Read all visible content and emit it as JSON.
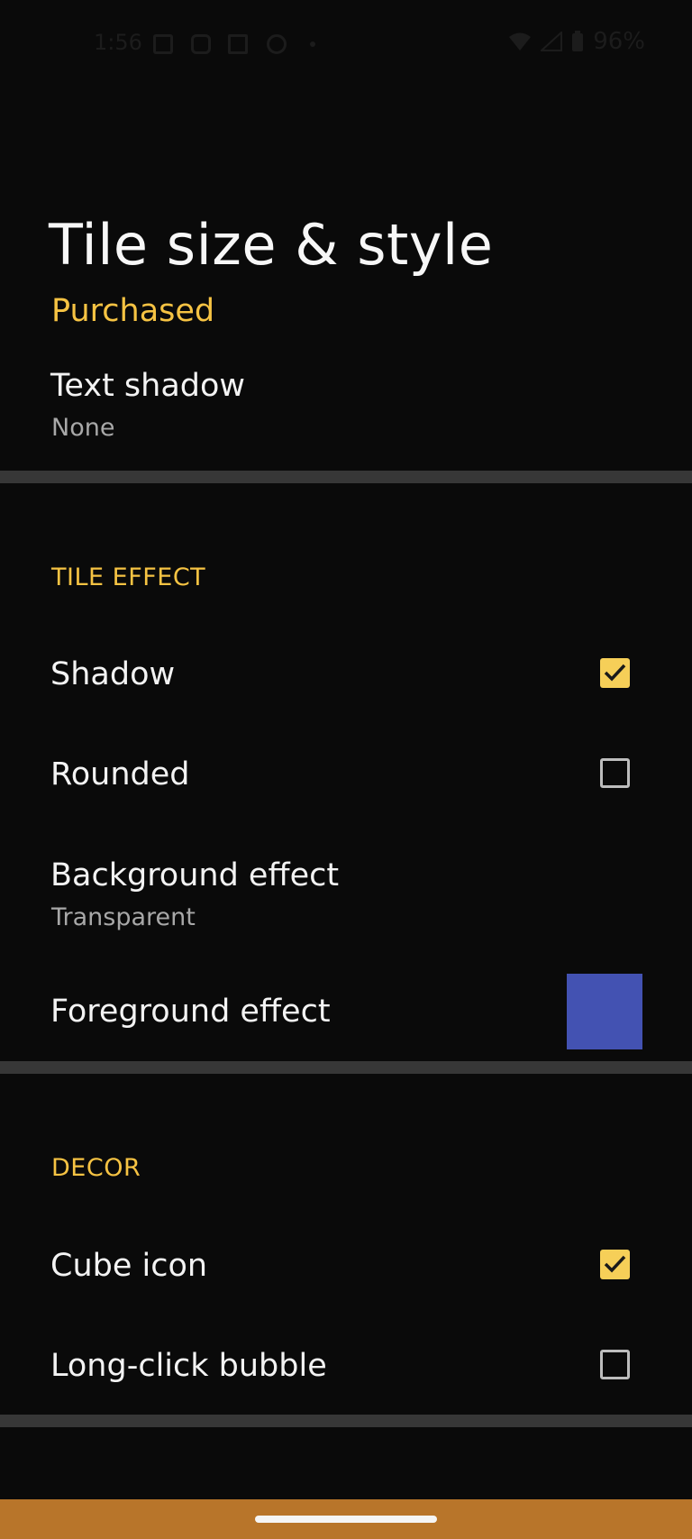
{
  "status_bar": {
    "time": "1:56",
    "battery": "96%",
    "icons": [
      "image-icon",
      "instagram-icon",
      "mail-icon",
      "alarm-icon",
      "wifi-icon",
      "signal-icon",
      "battery-icon"
    ]
  },
  "header": {
    "title": "Tile size & style",
    "purchase_status": "Purchased"
  },
  "text_shadow": {
    "label": "Text shadow",
    "value": "None"
  },
  "tile_effect": {
    "section_title": "TILE EFFECT",
    "shadow": {
      "label": "Shadow",
      "checked": true
    },
    "rounded": {
      "label": "Rounded",
      "checked": false
    },
    "background_effect": {
      "label": "Background effect",
      "value": "Transparent"
    },
    "foreground_effect": {
      "label": "Foreground effect",
      "color": "#4352b2"
    }
  },
  "decor": {
    "section_title": "DECOR",
    "cube_icon": {
      "label": "Cube icon",
      "checked": true
    },
    "long_click_bubble": {
      "label": "Long-click bubble",
      "checked": false
    }
  },
  "colors": {
    "accent": "#f6c343",
    "background": "#0a0a0a",
    "navbar": "#b8752a"
  }
}
